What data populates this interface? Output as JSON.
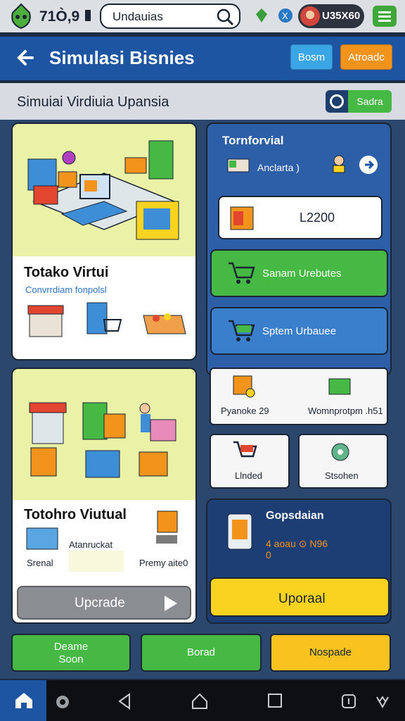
{
  "statusbar": {
    "score": "71Ò,9",
    "search_value": "Undauias",
    "pill_text": "U35X60",
    "icons": [
      "leaf-logo-icon",
      "search-icon",
      "gem-icon",
      "x-coin-icon",
      "avatar-icon",
      "menu-icon"
    ]
  },
  "header": {
    "title": "Simulasi Bisnies",
    "btn1": "Bosm",
    "btn2": "Atroadc"
  },
  "subbar": {
    "title": "Simuiai Virdiuia Upansia",
    "toggle_label": "Sadra"
  },
  "card1": {
    "title": "Totako Virtui",
    "subtitle": "Convrrdiam fonpolsl"
  },
  "card2": {
    "title": "Totohro Viutual",
    "label_left": "Srenal",
    "label_mid": "Atanruckat",
    "label_right": "Premy aite0"
  },
  "upgrade_button": "Upcrade",
  "right_panel": {
    "title": "Tornforvial",
    "sub": "Anclarta  )",
    "price": "L2200",
    "btn_green": "Sanam Urebutes",
    "btn_blue": "Sptem Urbauee",
    "tile1": "Pyanoke  29",
    "tile2": "Womnprotpm .h51",
    "tile3": "Llnded",
    "tile4": "Stsohen"
  },
  "g_panel": {
    "title": "Gopsdaian",
    "line1": "4  aoau  ⊙  N96",
    "line2": "0",
    "btn": "Uporaal"
  },
  "bottom": {
    "b1_line1": "Deame",
    "b1_line2": "Soon",
    "b2": "Borad",
    "b3": "Nospade"
  },
  "colors": {
    "header_blue": "#1e55a3",
    "green": "#45b943",
    "orange": "#f2931c",
    "yellow": "#f9d31f",
    "panel": "#2b476e"
  }
}
